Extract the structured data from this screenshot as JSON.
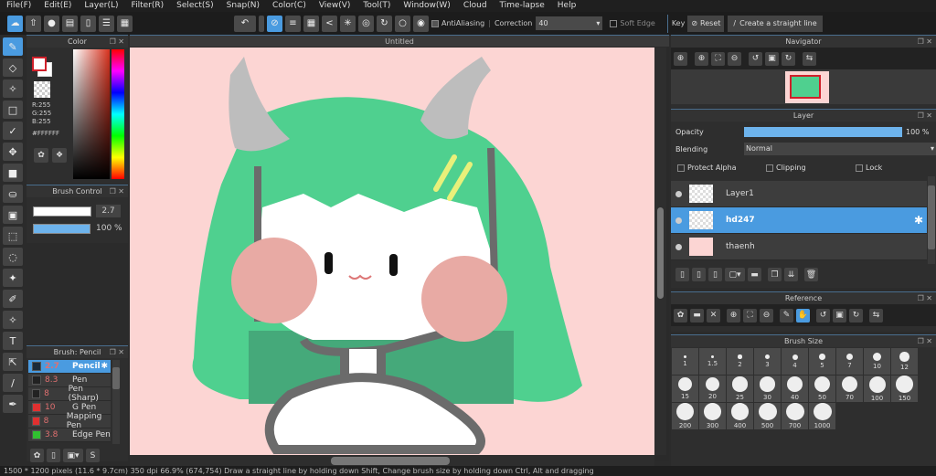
{
  "menu": [
    "File(F)",
    "Edit(E)",
    "Layer(L)",
    "Filter(R)",
    "Select(S)",
    "Snap(N)",
    "Color(C)",
    "View(V)",
    "Tool(T)",
    "Window(W)",
    "Cloud",
    "Time-lapse",
    "Help"
  ],
  "toolbar": {
    "antialiasing_label": "AntiAliasing",
    "antialiasing_checked": true,
    "correction_label": "Correction",
    "correction_value": "40",
    "soft_edge_label": "Soft Edge",
    "soft_edge_checked": false,
    "key_label": "Key",
    "reset_label": "Reset",
    "straight_line_label": "Create a straight line"
  },
  "color_panel": {
    "title": "Color",
    "r": "R:255",
    "g": "G:255",
    "b": "B:255",
    "hex": "#FFFFFF",
    "primary_color": "#ffffff",
    "primary_border": "#d0202a"
  },
  "brush_control": {
    "title": "Brush Control",
    "size": "2.7",
    "opacity": "100 %"
  },
  "document": {
    "title": "Untitled"
  },
  "brush_panel": {
    "title": "Brush: Pencil",
    "brushes": [
      {
        "size": "2.7",
        "name": "Pencil",
        "color": "#1a2a3a",
        "selected": true
      },
      {
        "size": "8.3",
        "name": "Pen",
        "color": "#222222"
      },
      {
        "size": "8",
        "name": "Pen (Sharp)",
        "color": "#222222"
      },
      {
        "size": "10",
        "name": "G Pen",
        "color": "#e03030"
      },
      {
        "size": "8",
        "name": "Mapping Pen",
        "color": "#e03030"
      },
      {
        "size": "3.8",
        "name": "Edge Pen",
        "color": "#30c030"
      }
    ]
  },
  "status": "1500 * 1200 pixels (11.6 * 9.7cm) 350 dpi 66.9% (674,754) Draw a straight line by holding down Shift, Change brush size by holding down Ctrl, Alt and dragging",
  "navigator": {
    "title": "Navigator"
  },
  "layer_panel": {
    "title": "Layer",
    "opacity_label": "Opacity",
    "opacity_value": "100 %",
    "opacity": 1.0,
    "blending_label": "Blending",
    "blending_value": "Normal",
    "protect_alpha": "Protect Alpha",
    "clipping": "Clipping",
    "lock": "Lock",
    "layers": [
      {
        "name": "Layer1",
        "selected": false
      },
      {
        "name": "hd247",
        "selected": true
      },
      {
        "name": "thaenh",
        "selected": false
      }
    ]
  },
  "reference": {
    "title": "Reference"
  },
  "brush_size": {
    "title": "Brush Size",
    "sizes": [
      "1",
      "1.5",
      "2",
      "3",
      "4",
      "5",
      "7",
      "10",
      "12",
      "15",
      "20",
      "25",
      "30",
      "40",
      "50",
      "70",
      "100",
      "150",
      "200",
      "300",
      "400",
      "500",
      "700",
      "1000"
    ]
  },
  "colors": {
    "accent": "#4a9be0",
    "canvas_bg": "#fcd5d3",
    "hair": "#4fd08f",
    "hair_dark": "#45a97a",
    "outline": "#6b6b6b",
    "cheek": "#e8aaa4",
    "horn": "#bdbdbd"
  }
}
